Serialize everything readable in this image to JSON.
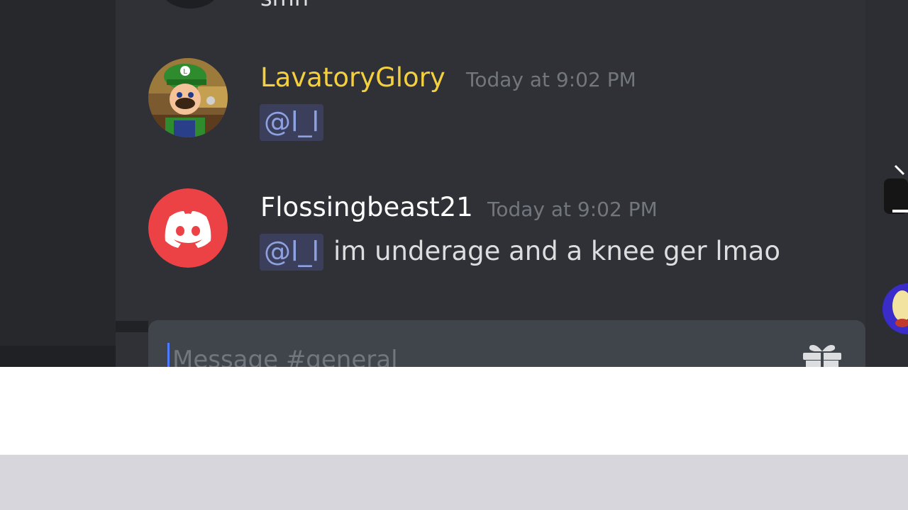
{
  "previous_message": {
    "partial_text": "smh"
  },
  "messages": [
    {
      "username": "LavatoryGlory",
      "username_color": "#f4d03f",
      "timestamp": "Today at 9:02 PM",
      "mention": "@l_l",
      "text": "",
      "avatar_icon": "luigi-avatar-icon"
    },
    {
      "username": "Flossingbeast21",
      "username_color": "#ffffff",
      "timestamp": "Today at 9:02 PM",
      "mention": "@l_l",
      "text": "im underage and a knee ger lmao",
      "avatar_icon": "discord-logo-avatar-icon"
    }
  ],
  "composer": {
    "placeholder": "Message #general",
    "gift_icon": "gift-icon"
  },
  "colors": {
    "mention_text": "#8ea1e1",
    "mention_bg": "#3b3f5c",
    "discord_red": "#ed4245"
  }
}
